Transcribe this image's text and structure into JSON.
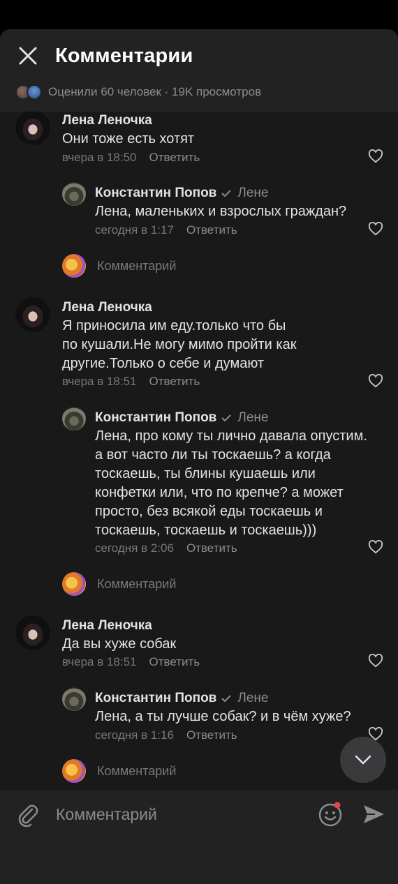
{
  "header": {
    "title": "Комментарии",
    "likes_summary": "Оценили 60 человек · 19K просмотров"
  },
  "comments": [
    {
      "author": "Лена Леночка",
      "text": "Они тоже есть хотят",
      "time": "вчера в 18:50",
      "reply_label": "Ответить",
      "reply": {
        "author": "Константин Попов",
        "reply_to": "Лене",
        "text": "Лена, маленьких и взрослых граждан?",
        "time": "сегодня в 1:17",
        "reply_label": "Ответить"
      },
      "write_placeholder": "Комментарий"
    },
    {
      "author": "Лена Леночка",
      "text_lines": [
        "Я приносила им еду.только что бы",
        "по кушали.Не могу мимо пройти как",
        "другие.Только о себе и думают"
      ],
      "time": "вчера в 18:51",
      "reply_label": "Ответить",
      "reply": {
        "author": "Константин Попов",
        "reply_to": "Лене",
        "text_lines": [
          "Лена, про кому ты лично давала опустим.",
          "а вот часто ли ты тоскаешь? а когда",
          "тоскаешь, ты блины кушаешь или",
          "конфетки или, что по крепче? а может",
          "просто, без всякой еды тоскаешь и",
          "тоскаешь, тоскаешь и тоскаешь)))"
        ],
        "time": "сегодня в 2:06",
        "reply_label": "Ответить"
      },
      "write_placeholder": "Комментарий"
    },
    {
      "author": "Лена Леночка",
      "text": "Да вы хуже собак",
      "time": "вчера в 18:51",
      "reply_label": "Ответить",
      "reply": {
        "author": "Константин Попов",
        "reply_to": "Лене",
        "text": "Лена, а ты лучше собак? и в чём хуже?",
        "time": "сегодня в 1:16",
        "reply_label": "Ответить"
      },
      "write_placeholder": "Комментарий"
    }
  ],
  "composer": {
    "placeholder": "Комментарий"
  },
  "icons": {
    "close": "close-icon",
    "heart": "heart-icon",
    "verified": "check-icon",
    "scroll_down": "chevron-down-icon",
    "attach": "paperclip-icon",
    "emoji": "smile-icon",
    "send": "send-icon"
  },
  "colors": {
    "background": "#191919",
    "header": "#222222",
    "notification_dot": "#e64646"
  }
}
